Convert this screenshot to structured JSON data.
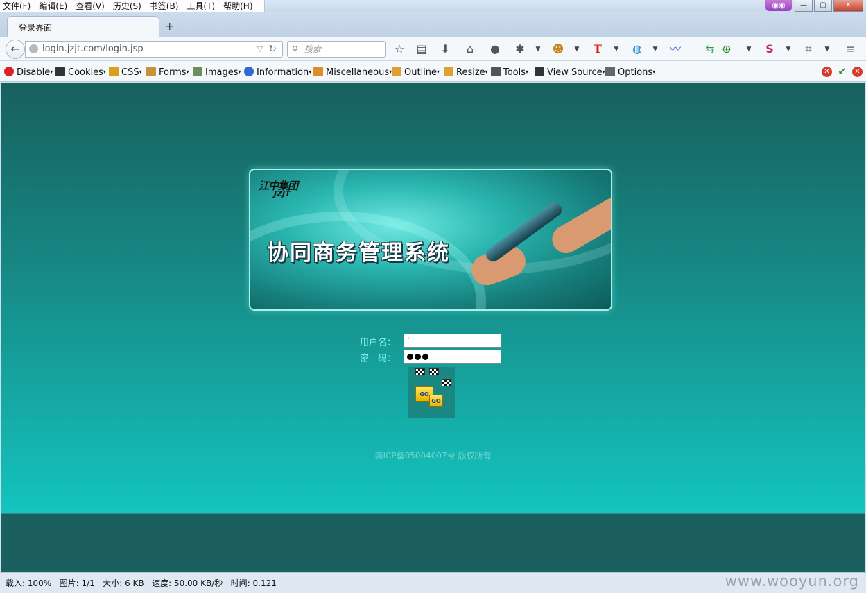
{
  "browser": {
    "menu": [
      "文件(F)",
      "编辑(E)",
      "查看(V)",
      "历史(S)",
      "书签(B)",
      "工具(T)",
      "帮助(H)"
    ],
    "tab_title": "登录界面",
    "new_tab": "+",
    "url": "login.jzjt.com/login.jsp",
    "search_placeholder": "搜索",
    "window_controls": {
      "minimize": "—",
      "maximize": "▢",
      "close": "✕"
    }
  },
  "devtoolbar": {
    "items": [
      {
        "label": "Disable",
        "icon": "disable-icon",
        "color": "#d22"
      },
      {
        "label": "Cookies",
        "icon": "cookies-icon",
        "color": "#333"
      },
      {
        "label": "CSS",
        "icon": "css-icon",
        "color": "#d9a020"
      },
      {
        "label": "Forms",
        "icon": "forms-icon",
        "color": "#c8923a"
      },
      {
        "label": "Images",
        "icon": "images-icon",
        "color": "#6a8f5a"
      },
      {
        "label": "Information",
        "icon": "information-icon",
        "color": "#2f6bd0"
      },
      {
        "label": "Miscellaneous",
        "icon": "miscellaneous-icon",
        "color": "#d9902a"
      },
      {
        "label": "Outline",
        "icon": "outline-icon",
        "color": "#e0a030"
      },
      {
        "label": "Resize",
        "icon": "resize-icon",
        "color": "#e0a030"
      },
      {
        "label": "Tools",
        "icon": "tools-icon",
        "color": "#555"
      },
      {
        "label": "View Source",
        "icon": "view-source-icon",
        "color": "#333"
      },
      {
        "label": "Options",
        "icon": "options-icon",
        "color": "#666"
      }
    ]
  },
  "page": {
    "logo_text": "江中集团",
    "logo_sub": "JZJT",
    "system_title": "协同商务管理系统",
    "username_label": "用户名：",
    "username_value": "'",
    "password_label": "密　码：",
    "go_label": "GO",
    "copyright": "赣ICP备05004007号 版权所有"
  },
  "statusbar": {
    "text": "载入: 100%   图片: 1/1   大小: 6 KB   速度: 50.00 KB/秒   时间: 0.121"
  },
  "watermark": "www.wooyun.org",
  "colors": {
    "page_bg_top": "#17605e",
    "page_bg_bottom": "#14c4bf",
    "label_color": "#7ff2ec"
  }
}
